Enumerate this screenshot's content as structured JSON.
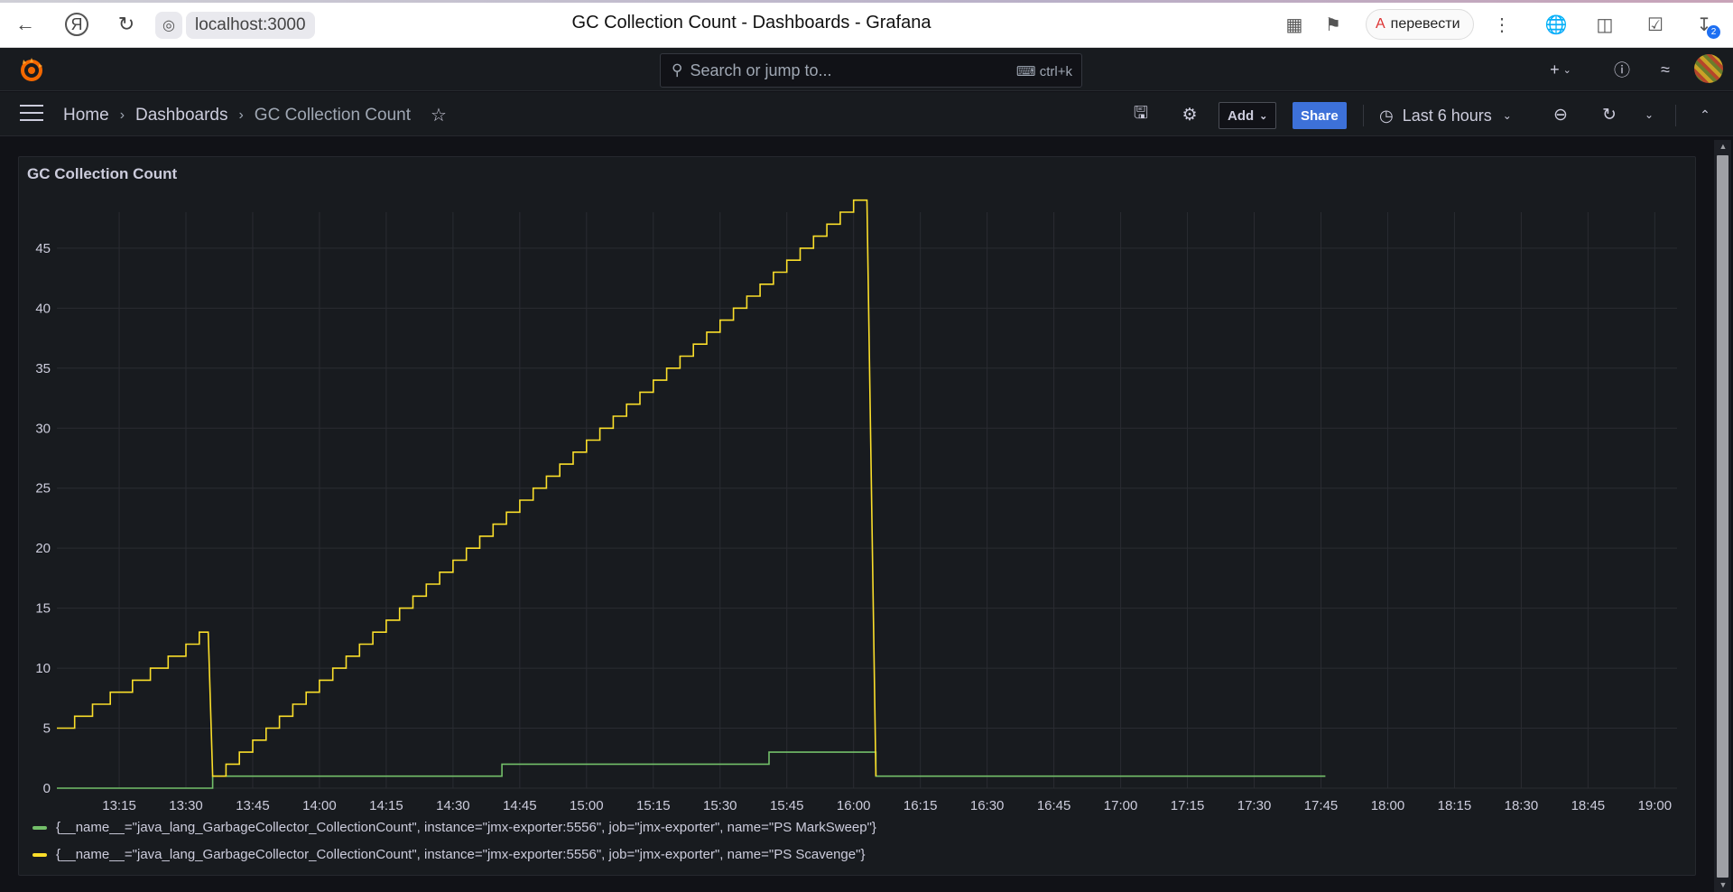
{
  "browser": {
    "url": "localhost:3000",
    "tab_title": "GC Collection Count - Dashboards - Grafana",
    "translate_label": "перевести",
    "downloads_count": "2"
  },
  "topnav": {
    "search_placeholder": "Search or jump to...",
    "search_shortcut": "ctrl+k"
  },
  "toolbar": {
    "breadcrumb": [
      "Home",
      "Dashboards",
      "GC Collection Count"
    ],
    "add_label": "Add",
    "share_label": "Share",
    "time_range": "Last 6 hours"
  },
  "panel": {
    "title": "GC Collection Count"
  },
  "colors": {
    "series_green": "#73bf69",
    "series_yellow": "#fade2a",
    "share_blue": "#3d71d9"
  },
  "chart_data": {
    "type": "line",
    "title": "GC Collection Count",
    "xlabel": "",
    "ylabel": "",
    "x_ticks": [
      "13:15",
      "13:30",
      "13:45",
      "14:00",
      "14:15",
      "14:30",
      "14:45",
      "15:00",
      "15:15",
      "15:30",
      "15:45",
      "16:00",
      "16:15",
      "16:30",
      "16:45",
      "17:00",
      "17:15",
      "17:30",
      "17:45",
      "18:00",
      "18:15",
      "18:30",
      "18:45",
      "19:00"
    ],
    "y_ticks": [
      0,
      5,
      10,
      15,
      20,
      25,
      30,
      35,
      40,
      45
    ],
    "ylim": [
      0,
      48
    ],
    "xlim": [
      "13:01",
      "19:05"
    ],
    "grid": true,
    "legend_position": "bottom",
    "series": [
      {
        "name": "{__name__=\"java_lang_GarbageCollector_CollectionCount\", instance=\"jmx-exporter:5556\", job=\"jmx-exporter\", name=\"PS MarkSweep\"}",
        "color": "#73bf69",
        "step": true,
        "points": [
          [
            "13:01",
            0
          ],
          [
            "13:36",
            0
          ],
          [
            "13:36",
            1
          ],
          [
            "14:41",
            1
          ],
          [
            "14:41",
            2
          ],
          [
            "15:41",
            2
          ],
          [
            "15:41",
            3
          ],
          [
            "16:05",
            3
          ],
          [
            "16:05",
            1
          ],
          [
            "17:46",
            1
          ]
        ]
      },
      {
        "name": "{__name__=\"java_lang_GarbageCollector_CollectionCount\", instance=\"jmx-exporter:5556\", job=\"jmx-exporter\", name=\"PS Scavenge\"}",
        "color": "#fade2a",
        "step": true,
        "points": [
          [
            "13:01",
            5
          ],
          [
            "13:05",
            5
          ],
          [
            "13:05",
            6
          ],
          [
            "13:09",
            6
          ],
          [
            "13:09",
            7
          ],
          [
            "13:13",
            7
          ],
          [
            "13:13",
            8
          ],
          [
            "13:18",
            8
          ],
          [
            "13:18",
            9
          ],
          [
            "13:22",
            9
          ],
          [
            "13:22",
            10
          ],
          [
            "13:26",
            10
          ],
          [
            "13:26",
            11
          ],
          [
            "13:30",
            11
          ],
          [
            "13:30",
            12
          ],
          [
            "13:33",
            12
          ],
          [
            "13:33",
            13
          ],
          [
            "13:35",
            13
          ],
          [
            "13:36",
            1
          ],
          [
            "13:39",
            1
          ],
          [
            "13:39",
            2
          ],
          [
            "13:42",
            2
          ],
          [
            "13:42",
            3
          ],
          [
            "13:45",
            3
          ],
          [
            "13:45",
            4
          ],
          [
            "13:48",
            4
          ],
          [
            "13:48",
            5
          ],
          [
            "13:51",
            5
          ],
          [
            "13:51",
            6
          ],
          [
            "13:54",
            6
          ],
          [
            "13:54",
            7
          ],
          [
            "13:57",
            7
          ],
          [
            "13:57",
            8
          ],
          [
            "14:00",
            8
          ],
          [
            "14:00",
            9
          ],
          [
            "14:03",
            9
          ],
          [
            "14:03",
            10
          ],
          [
            "14:06",
            10
          ],
          [
            "14:06",
            11
          ],
          [
            "14:09",
            11
          ],
          [
            "14:09",
            12
          ],
          [
            "14:12",
            12
          ],
          [
            "14:12",
            13
          ],
          [
            "14:15",
            13
          ],
          [
            "14:15",
            14
          ],
          [
            "14:18",
            14
          ],
          [
            "14:18",
            15
          ],
          [
            "14:21",
            15
          ],
          [
            "14:21",
            16
          ],
          [
            "14:24",
            16
          ],
          [
            "14:24",
            17
          ],
          [
            "14:27",
            17
          ],
          [
            "14:27",
            18
          ],
          [
            "14:30",
            18
          ],
          [
            "14:30",
            19
          ],
          [
            "14:33",
            19
          ],
          [
            "14:33",
            20
          ],
          [
            "14:36",
            20
          ],
          [
            "14:36",
            21
          ],
          [
            "14:39",
            21
          ],
          [
            "14:39",
            22
          ],
          [
            "14:42",
            22
          ],
          [
            "14:42",
            23
          ],
          [
            "14:45",
            23
          ],
          [
            "14:45",
            24
          ],
          [
            "14:48",
            24
          ],
          [
            "14:48",
            25
          ],
          [
            "14:51",
            25
          ],
          [
            "14:51",
            26
          ],
          [
            "14:54",
            26
          ],
          [
            "14:54",
            27
          ],
          [
            "14:57",
            27
          ],
          [
            "14:57",
            28
          ],
          [
            "15:00",
            28
          ],
          [
            "15:00",
            29
          ],
          [
            "15:03",
            29
          ],
          [
            "15:03",
            30
          ],
          [
            "15:06",
            30
          ],
          [
            "15:06",
            31
          ],
          [
            "15:09",
            31
          ],
          [
            "15:09",
            32
          ],
          [
            "15:12",
            32
          ],
          [
            "15:12",
            33
          ],
          [
            "15:15",
            33
          ],
          [
            "15:15",
            34
          ],
          [
            "15:18",
            34
          ],
          [
            "15:18",
            35
          ],
          [
            "15:21",
            35
          ],
          [
            "15:21",
            36
          ],
          [
            "15:24",
            36
          ],
          [
            "15:24",
            37
          ],
          [
            "15:27",
            37
          ],
          [
            "15:27",
            38
          ],
          [
            "15:30",
            38
          ],
          [
            "15:30",
            39
          ],
          [
            "15:33",
            39
          ],
          [
            "15:33",
            40
          ],
          [
            "15:36",
            40
          ],
          [
            "15:36",
            41
          ],
          [
            "15:39",
            41
          ],
          [
            "15:39",
            42
          ],
          [
            "15:42",
            42
          ],
          [
            "15:42",
            43
          ],
          [
            "15:45",
            43
          ],
          [
            "15:45",
            44
          ],
          [
            "15:48",
            44
          ],
          [
            "15:48",
            45
          ],
          [
            "15:51",
            45
          ],
          [
            "15:51",
            46
          ],
          [
            "15:54",
            46
          ],
          [
            "15:54",
            47
          ],
          [
            "15:57",
            47
          ],
          [
            "15:57",
            48
          ],
          [
            "16:00",
            48
          ],
          [
            "16:00",
            49
          ],
          [
            "16:03",
            49
          ],
          [
            "16:05",
            1
          ]
        ]
      }
    ]
  }
}
